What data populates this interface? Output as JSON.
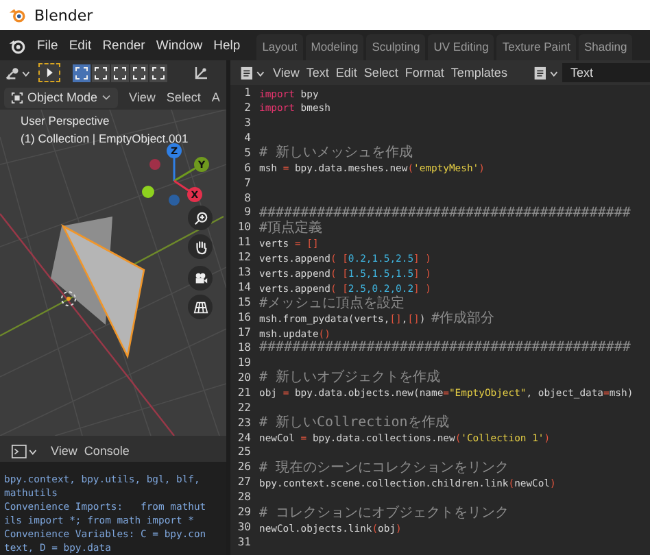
{
  "window": {
    "title": "Blender"
  },
  "menu": [
    "File",
    "Edit",
    "Render",
    "Window",
    "Help"
  ],
  "workspaces": [
    "Layout",
    "Modeling",
    "Sculpting",
    "UV Editing",
    "Texture Paint",
    "Shading"
  ],
  "viewport": {
    "selection_modes": [
      {
        "selected": true
      },
      {
        "selected": false
      },
      {
        "selected": false
      },
      {
        "selected": false
      },
      {
        "selected": false
      }
    ],
    "mode": "Object Mode",
    "header_menus": [
      "View",
      "Select",
      "A"
    ],
    "overlay_title": "User Perspective",
    "overlay_info": "(1) Collection | EmptyObject.001",
    "gizmo_axes": [
      "Z",
      "Y",
      "X"
    ]
  },
  "text_editor": {
    "menus": [
      "View",
      "Text",
      "Edit",
      "Select",
      "Format",
      "Templates"
    ],
    "text_name": "Text",
    "lines": [
      {
        "number": "1",
        "tokens": [
          {
            "kind": "keyword",
            "text": "import"
          },
          {
            "kind": "plain",
            "text": " bpy"
          }
        ]
      },
      {
        "number": "2",
        "tokens": [
          {
            "kind": "keyword",
            "text": "import"
          },
          {
            "kind": "plain",
            "text": " bmesh"
          }
        ]
      },
      {
        "number": "3"
      },
      {
        "number": "4"
      },
      {
        "number": "5",
        "tokens": [
          {
            "kind": "comment",
            "text": "# 新しいメッシュを作成"
          }
        ]
      },
      {
        "number": "6",
        "tokens": [
          {
            "kind": "plain",
            "text": "msh "
          },
          {
            "kind": "symbol",
            "text": "="
          },
          {
            "kind": "plain",
            "text": " bpy.data.meshes.new"
          },
          {
            "kind": "symbol",
            "text": "("
          },
          {
            "kind": "string",
            "text": "'emptyMesh'"
          },
          {
            "kind": "symbol",
            "text": ")"
          }
        ]
      },
      {
        "number": "7"
      },
      {
        "number": "8"
      },
      {
        "number": "9",
        "tokens": [
          {
            "kind": "comment",
            "text": "#############################################"
          }
        ]
      },
      {
        "number": "10",
        "tokens": [
          {
            "kind": "comment",
            "text": "#頂点定義"
          }
        ]
      },
      {
        "number": "11",
        "tokens": [
          {
            "kind": "plain",
            "text": "verts "
          },
          {
            "kind": "symbol",
            "text": "="
          },
          {
            "kind": "symbol",
            "text": " []"
          }
        ]
      },
      {
        "number": "12",
        "tokens": [
          {
            "kind": "plain",
            "text": "verts.append"
          },
          {
            "kind": "symbol",
            "text": "( ["
          },
          {
            "kind": "number",
            "text": "0.2,1.5,2.5"
          },
          {
            "kind": "symbol",
            "text": "] )"
          }
        ]
      },
      {
        "number": "13",
        "tokens": [
          {
            "kind": "plain",
            "text": "verts.append"
          },
          {
            "kind": "symbol",
            "text": "( ["
          },
          {
            "kind": "number",
            "text": "1.5,1.5,1.5"
          },
          {
            "kind": "symbol",
            "text": "] )"
          }
        ]
      },
      {
        "number": "14",
        "tokens": [
          {
            "kind": "plain",
            "text": "verts.append"
          },
          {
            "kind": "symbol",
            "text": "( ["
          },
          {
            "kind": "number",
            "text": "2.5,0.2,0.2"
          },
          {
            "kind": "symbol",
            "text": "] )"
          }
        ]
      },
      {
        "number": "15",
        "tokens": [
          {
            "kind": "comment",
            "text": "#メッシュに頂点を設定"
          }
        ]
      },
      {
        "number": "16",
        "tokens": [
          {
            "kind": "plain",
            "text": "msh.from_pydata(verts,"
          },
          {
            "kind": "symbol",
            "text": "[]"
          },
          {
            "kind": "plain",
            "text": ","
          },
          {
            "kind": "symbol",
            "text": "[]"
          },
          {
            "kind": "plain",
            "text": ") "
          },
          {
            "kind": "comment",
            "text": "#作成部分"
          }
        ]
      },
      {
        "number": "17",
        "tokens": [
          {
            "kind": "plain",
            "text": "msh.update"
          },
          {
            "kind": "symbol",
            "text": "()"
          }
        ]
      },
      {
        "number": "18",
        "tokens": [
          {
            "kind": "comment",
            "text": "#############################################"
          }
        ]
      },
      {
        "number": "19"
      },
      {
        "number": "20",
        "tokens": [
          {
            "kind": "comment",
            "text": "# 新しいオブジェクトを作成"
          }
        ]
      },
      {
        "number": "21",
        "tokens": [
          {
            "kind": "plain",
            "text": "obj "
          },
          {
            "kind": "symbol",
            "text": "="
          },
          {
            "kind": "plain",
            "text": " bpy.data.objects.new(name"
          },
          {
            "kind": "symbol",
            "text": "="
          },
          {
            "kind": "string",
            "text": "\"EmptyObject\""
          },
          {
            "kind": "plain",
            "text": ", object_data"
          },
          {
            "kind": "symbol",
            "text": "="
          },
          {
            "kind": "plain",
            "text": "msh)"
          }
        ]
      },
      {
        "number": "22"
      },
      {
        "number": "23",
        "tokens": [
          {
            "kind": "comment",
            "text": "# 新しいCollrectionを作成"
          }
        ]
      },
      {
        "number": "24",
        "tokens": [
          {
            "kind": "plain",
            "text": "newCol "
          },
          {
            "kind": "symbol",
            "text": "="
          },
          {
            "kind": "plain",
            "text": " bpy.data.collections.new"
          },
          {
            "kind": "symbol",
            "text": "("
          },
          {
            "kind": "string",
            "text": "'Collection 1'"
          },
          {
            "kind": "symbol",
            "text": ")"
          }
        ]
      },
      {
        "number": "25"
      },
      {
        "number": "26",
        "tokens": [
          {
            "kind": "comment",
            "text": "# 現在のシーンにコレクションをリンク"
          }
        ]
      },
      {
        "number": "27",
        "tokens": [
          {
            "kind": "plain",
            "text": "bpy.context.scene.collection.children.link"
          },
          {
            "kind": "symbol",
            "text": "("
          },
          {
            "kind": "plain",
            "text": "newCol"
          },
          {
            "kind": "symbol",
            "text": ")"
          }
        ]
      },
      {
        "number": "28"
      },
      {
        "number": "29",
        "tokens": [
          {
            "kind": "comment",
            "text": "# コレクションにオブジェクトをリンク"
          }
        ]
      },
      {
        "number": "30",
        "tokens": [
          {
            "kind": "plain",
            "text": "newCol.objects.link"
          },
          {
            "kind": "symbol",
            "text": "("
          },
          {
            "kind": "plain",
            "text": "obj"
          },
          {
            "kind": "symbol",
            "text": ")"
          }
        ]
      },
      {
        "number": "31"
      }
    ]
  },
  "console": {
    "menus": [
      "View",
      "Console"
    ],
    "lines": [
      "bpy.context, bpy.utils, bgl, blf,",
      "mathutils",
      "Convenience Imports:   from mathut",
      "ils import *; from math import *",
      "Convenience Variables: C = bpy.con",
      "text, D = bpy.data"
    ]
  }
}
